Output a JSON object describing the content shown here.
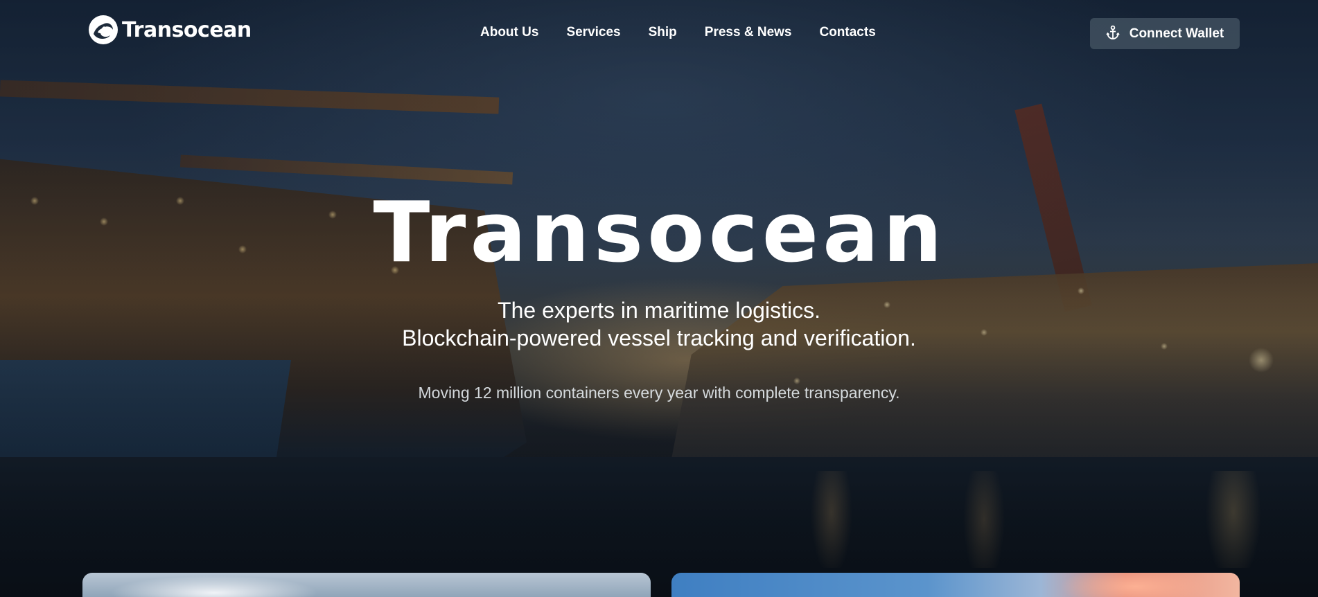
{
  "header": {
    "logo": {
      "icon": "wave-logo-icon",
      "text": "Transocean"
    },
    "nav": [
      {
        "label": "About Us"
      },
      {
        "label": "Services"
      },
      {
        "label": "Ship"
      },
      {
        "label": "Press & News"
      },
      {
        "label": "Contacts"
      }
    ],
    "connect_wallet": {
      "icon": "anchor-icon",
      "label": "Connect Wallet"
    }
  },
  "hero": {
    "title": "Transocean",
    "tagline_line1": "The experts in maritime logistics.",
    "tagline_line2": "Blockchain-powered vessel tracking and verification.",
    "subtext": "Moving 12 million containers every year with complete transparency."
  },
  "colors": {
    "text": "#ffffff",
    "button_bg": "#46556480",
    "overlay": "#0a1423"
  }
}
